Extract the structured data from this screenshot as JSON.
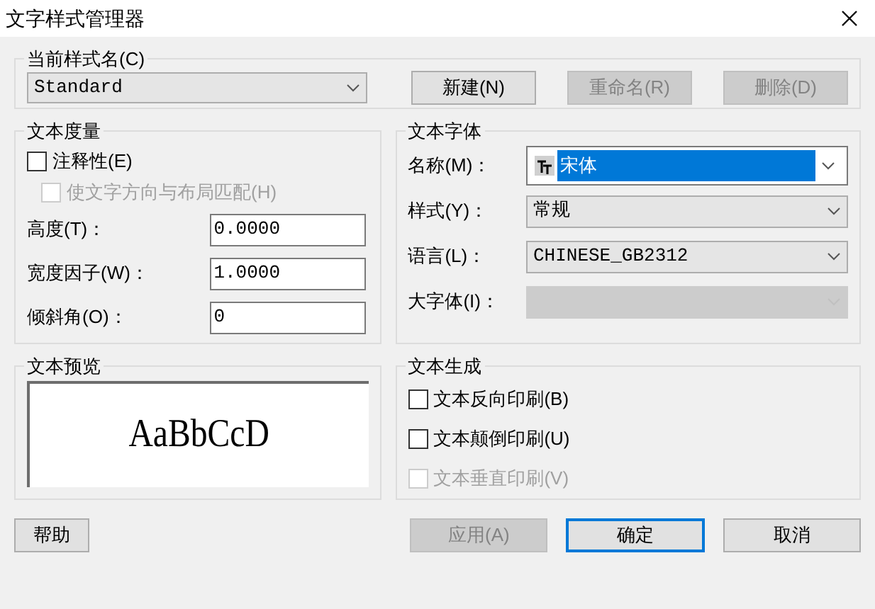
{
  "window": {
    "title": "文字样式管理器"
  },
  "current_style": {
    "title": "当前样式名(C)",
    "value": "Standard",
    "buttons": [
      {
        "label": "新建(N)",
        "disabled": false
      },
      {
        "label": "重命名(R)",
        "disabled": true
      },
      {
        "label": "删除(D)",
        "disabled": true
      }
    ]
  },
  "text_metrics": {
    "title": "文本度量",
    "checkboxes": [
      {
        "label": "注释性(E)",
        "checked": false,
        "disabled": false
      },
      {
        "label": "使文字方向与布局匹配(H)",
        "checked": false,
        "disabled": true
      }
    ],
    "fields": [
      {
        "label": "高度(T)：",
        "value": "0.0000"
      },
      {
        "label": "宽度因子(W)：",
        "value": "1.0000"
      },
      {
        "label": "倾斜角(O)：",
        "value": "0"
      }
    ]
  },
  "text_font": {
    "title": "文本字体",
    "fields": [
      {
        "label": "名称(M)：",
        "value": "宋体",
        "kind": "font",
        "disabled": false
      },
      {
        "label": "样式(Y)：",
        "value": "常规",
        "kind": "select",
        "disabled": false
      },
      {
        "label": "语言(L)：",
        "value": "CHINESE_GB2312",
        "kind": "select",
        "disabled": false
      },
      {
        "label": "大字体(I)：",
        "kind": "select",
        "disabled": true
      }
    ]
  },
  "preview": {
    "title": "文本预览",
    "sample": "AaBbCcD"
  },
  "text_effects": {
    "title": "文本生成",
    "checkboxes": [
      {
        "label": "文本反向印刷(B)",
        "checked": false,
        "disabled": false
      },
      {
        "label": "文本颠倒印刷(U)",
        "checked": false,
        "disabled": false
      },
      {
        "label": "文本垂直印刷(V)",
        "checked": false,
        "disabled": true
      }
    ]
  },
  "footer_buttons": [
    {
      "label": "帮助",
      "disabled": false,
      "default": false
    },
    {
      "label": "应用(A)",
      "disabled": true,
      "default": false
    },
    {
      "label": "确定",
      "disabled": false,
      "default": true
    },
    {
      "label": "取消",
      "disabled": false,
      "default": false
    }
  ]
}
